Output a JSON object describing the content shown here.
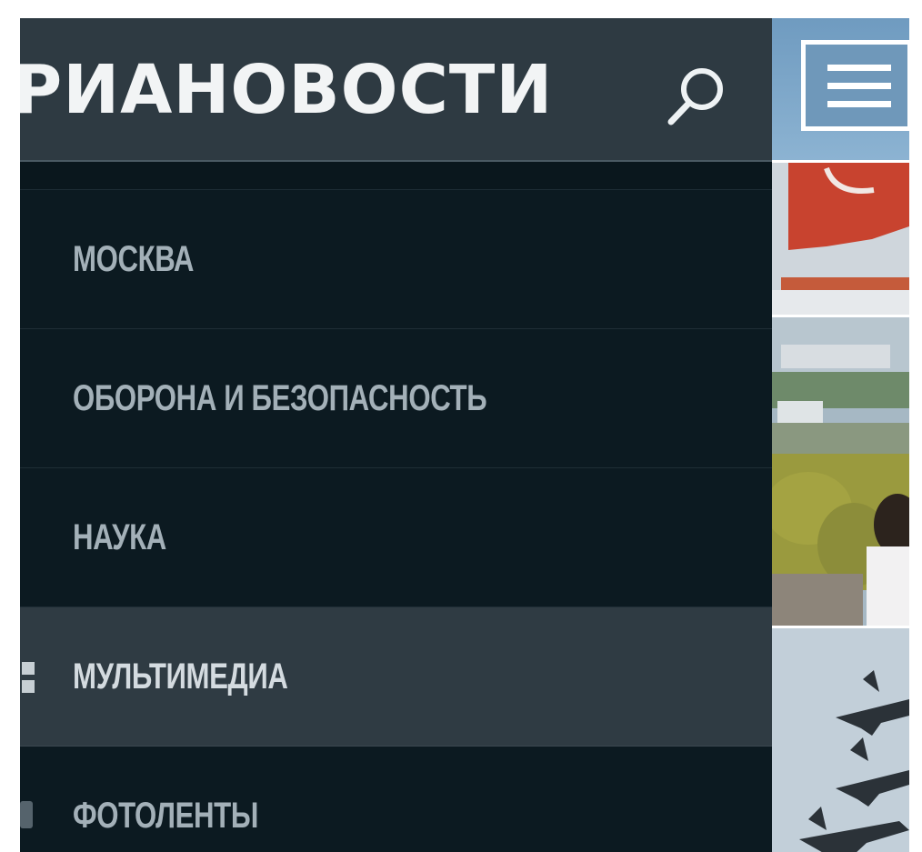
{
  "app": {
    "logo_text": "РИАНОВОСТИ"
  },
  "header": {
    "search_icon": "search-icon",
    "menu_icon": "hamburger-menu-icon"
  },
  "menu": {
    "items": [
      {
        "label": "МОСКВА",
        "active": false
      },
      {
        "label": "ОБОРОНА И БЕЗОПАСНОСТЬ",
        "active": false
      },
      {
        "label": "НАУКА",
        "active": false
      },
      {
        "label": "МУЛЬТИМЕДИА",
        "active": true,
        "icon": "grid-icon"
      },
      {
        "label": "ФОТОЛЕНТЫ",
        "active": false,
        "icon": "photo-icon"
      }
    ]
  },
  "colors": {
    "header_bg": "#2e3a42",
    "drawer_bg": "#0c1a21",
    "active_item_bg": "#2f3b43",
    "menu_text": "#a3b0b8",
    "content_accent": "#7fa8c8"
  }
}
